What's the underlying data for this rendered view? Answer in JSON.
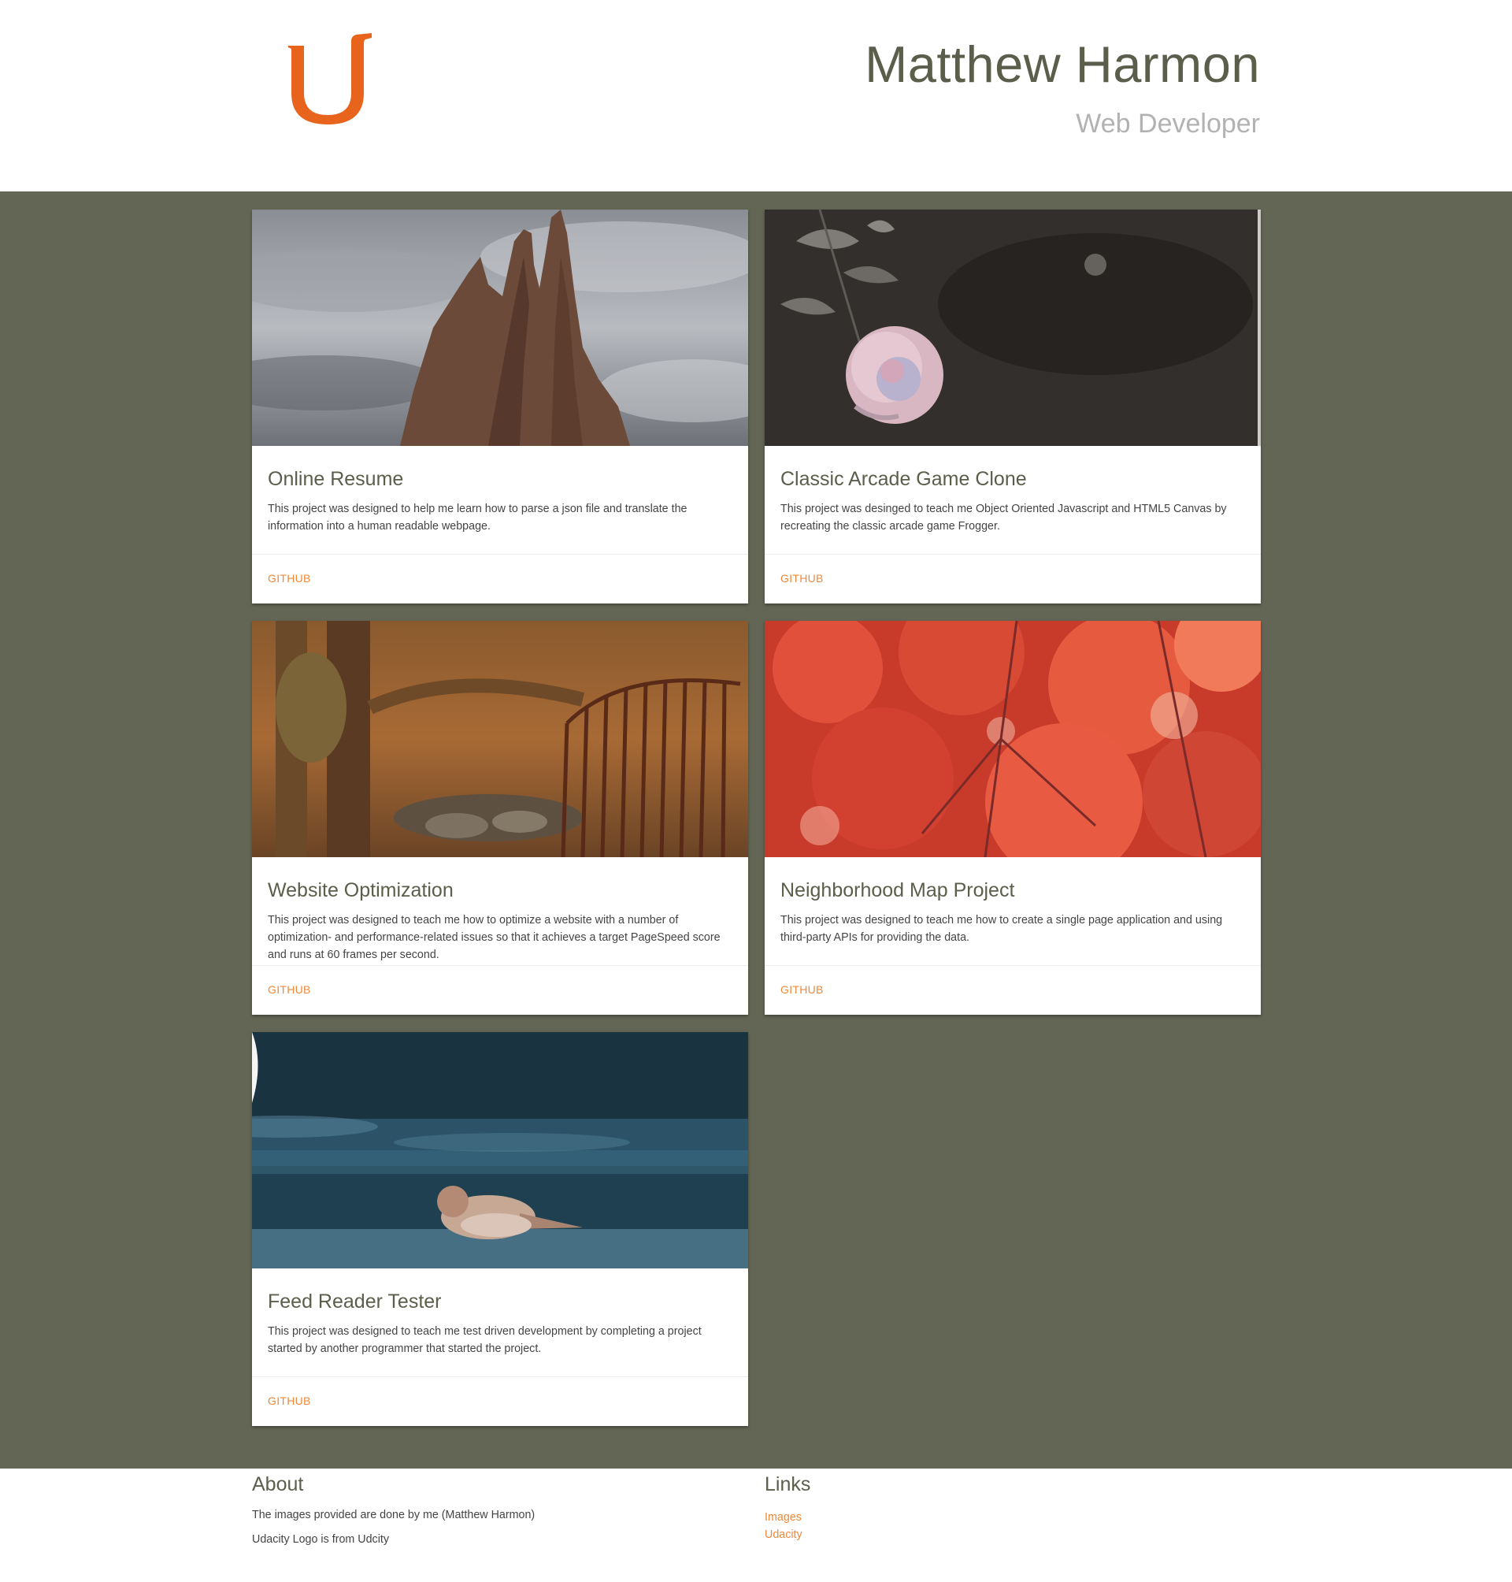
{
  "header": {
    "logo_label": "U",
    "name": "Matthew Harmon",
    "role": "Web Developer",
    "accent_color": "#e8641c"
  },
  "projects": [
    {
      "title": "Online Resume",
      "description": "This project was designed to help me learn how to parse a json file and translate the information into a human readable webpage.",
      "link": "GITHUB",
      "image": "rock-spires-photo"
    },
    {
      "title": "Classic Arcade Game Clone",
      "description": "This project was desinged to teach me Object Oriented Javascript and HTML5 Canvas by recreating the classic arcade game Frogger.",
      "link": "GITHUB",
      "image": "rose-photo"
    },
    {
      "title": "Website Optimization",
      "description": "This project was designed to teach me how to optimize a website with a number of optimization- and performance-related issues so that it achieves a target PageSpeed score and runs at 60 frames per second.",
      "link": "GITHUB",
      "image": "forest-gate-photo"
    },
    {
      "title": "Neighborhood Map Project",
      "description": "This project was designed to teach me how to create a single page application and using third-party APIs for providing the data.",
      "link": "GITHUB",
      "image": "red-maple-photo"
    },
    {
      "title": "Feed Reader Tester",
      "description": "This project was designed to teach me test driven development by completing a project started by another programmer that started the project.",
      "link": "GITHUB",
      "image": "sparrow-photo"
    }
  ],
  "footer": {
    "about_heading": "About",
    "about_lines": [
      "The images provided are done by me (Matthew Harmon)",
      "Udacity Logo is from Udcity"
    ],
    "links_heading": "Links",
    "links": [
      "Images",
      "Udacity"
    ]
  },
  "colors": {
    "main_bg": "#646655",
    "link": "#f0883a",
    "heading": "#5b5e4b"
  }
}
